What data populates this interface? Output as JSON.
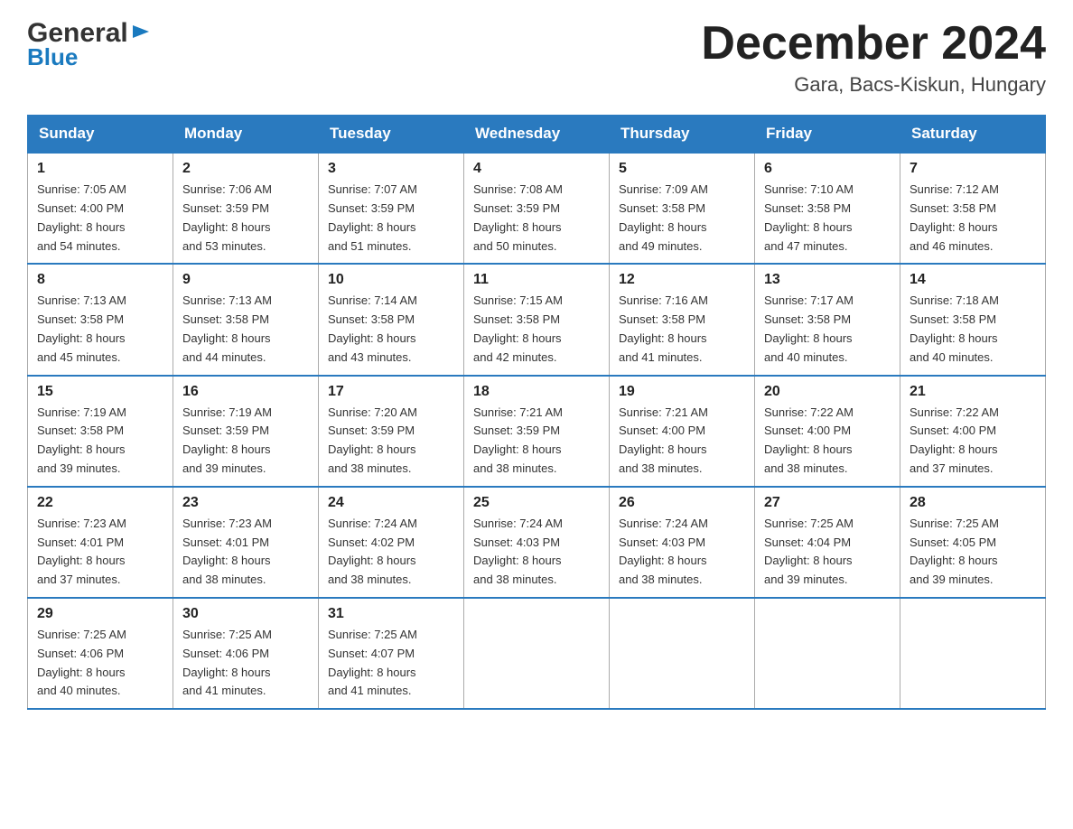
{
  "header": {
    "logo_general": "General",
    "logo_blue": "Blue",
    "month_title": "December 2024",
    "location": "Gara, Bacs-Kiskun, Hungary"
  },
  "days_of_week": [
    "Sunday",
    "Monday",
    "Tuesday",
    "Wednesday",
    "Thursday",
    "Friday",
    "Saturday"
  ],
  "weeks": [
    [
      {
        "day": "1",
        "sunrise": "7:05 AM",
        "sunset": "4:00 PM",
        "daylight": "8 hours and 54 minutes."
      },
      {
        "day": "2",
        "sunrise": "7:06 AM",
        "sunset": "3:59 PM",
        "daylight": "8 hours and 53 minutes."
      },
      {
        "day": "3",
        "sunrise": "7:07 AM",
        "sunset": "3:59 PM",
        "daylight": "8 hours and 51 minutes."
      },
      {
        "day": "4",
        "sunrise": "7:08 AM",
        "sunset": "3:59 PM",
        "daylight": "8 hours and 50 minutes."
      },
      {
        "day": "5",
        "sunrise": "7:09 AM",
        "sunset": "3:58 PM",
        "daylight": "8 hours and 49 minutes."
      },
      {
        "day": "6",
        "sunrise": "7:10 AM",
        "sunset": "3:58 PM",
        "daylight": "8 hours and 47 minutes."
      },
      {
        "day": "7",
        "sunrise": "7:12 AM",
        "sunset": "3:58 PM",
        "daylight": "8 hours and 46 minutes."
      }
    ],
    [
      {
        "day": "8",
        "sunrise": "7:13 AM",
        "sunset": "3:58 PM",
        "daylight": "8 hours and 45 minutes."
      },
      {
        "day": "9",
        "sunrise": "7:13 AM",
        "sunset": "3:58 PM",
        "daylight": "8 hours and 44 minutes."
      },
      {
        "day": "10",
        "sunrise": "7:14 AM",
        "sunset": "3:58 PM",
        "daylight": "8 hours and 43 minutes."
      },
      {
        "day": "11",
        "sunrise": "7:15 AM",
        "sunset": "3:58 PM",
        "daylight": "8 hours and 42 minutes."
      },
      {
        "day": "12",
        "sunrise": "7:16 AM",
        "sunset": "3:58 PM",
        "daylight": "8 hours and 41 minutes."
      },
      {
        "day": "13",
        "sunrise": "7:17 AM",
        "sunset": "3:58 PM",
        "daylight": "8 hours and 40 minutes."
      },
      {
        "day": "14",
        "sunrise": "7:18 AM",
        "sunset": "3:58 PM",
        "daylight": "8 hours and 40 minutes."
      }
    ],
    [
      {
        "day": "15",
        "sunrise": "7:19 AM",
        "sunset": "3:58 PM",
        "daylight": "8 hours and 39 minutes."
      },
      {
        "day": "16",
        "sunrise": "7:19 AM",
        "sunset": "3:59 PM",
        "daylight": "8 hours and 39 minutes."
      },
      {
        "day": "17",
        "sunrise": "7:20 AM",
        "sunset": "3:59 PM",
        "daylight": "8 hours and 38 minutes."
      },
      {
        "day": "18",
        "sunrise": "7:21 AM",
        "sunset": "3:59 PM",
        "daylight": "8 hours and 38 minutes."
      },
      {
        "day": "19",
        "sunrise": "7:21 AM",
        "sunset": "4:00 PM",
        "daylight": "8 hours and 38 minutes."
      },
      {
        "day": "20",
        "sunrise": "7:22 AM",
        "sunset": "4:00 PM",
        "daylight": "8 hours and 38 minutes."
      },
      {
        "day": "21",
        "sunrise": "7:22 AM",
        "sunset": "4:00 PM",
        "daylight": "8 hours and 37 minutes."
      }
    ],
    [
      {
        "day": "22",
        "sunrise": "7:23 AM",
        "sunset": "4:01 PM",
        "daylight": "8 hours and 37 minutes."
      },
      {
        "day": "23",
        "sunrise": "7:23 AM",
        "sunset": "4:01 PM",
        "daylight": "8 hours and 38 minutes."
      },
      {
        "day": "24",
        "sunrise": "7:24 AM",
        "sunset": "4:02 PM",
        "daylight": "8 hours and 38 minutes."
      },
      {
        "day": "25",
        "sunrise": "7:24 AM",
        "sunset": "4:03 PM",
        "daylight": "8 hours and 38 minutes."
      },
      {
        "day": "26",
        "sunrise": "7:24 AM",
        "sunset": "4:03 PM",
        "daylight": "8 hours and 38 minutes."
      },
      {
        "day": "27",
        "sunrise": "7:25 AM",
        "sunset": "4:04 PM",
        "daylight": "8 hours and 39 minutes."
      },
      {
        "day": "28",
        "sunrise": "7:25 AM",
        "sunset": "4:05 PM",
        "daylight": "8 hours and 39 minutes."
      }
    ],
    [
      {
        "day": "29",
        "sunrise": "7:25 AM",
        "sunset": "4:06 PM",
        "daylight": "8 hours and 40 minutes."
      },
      {
        "day": "30",
        "sunrise": "7:25 AM",
        "sunset": "4:06 PM",
        "daylight": "8 hours and 41 minutes."
      },
      {
        "day": "31",
        "sunrise": "7:25 AM",
        "sunset": "4:07 PM",
        "daylight": "8 hours and 41 minutes."
      },
      null,
      null,
      null,
      null
    ]
  ],
  "labels": {
    "sunrise": "Sunrise: ",
    "sunset": "Sunset: ",
    "daylight": "Daylight: "
  }
}
